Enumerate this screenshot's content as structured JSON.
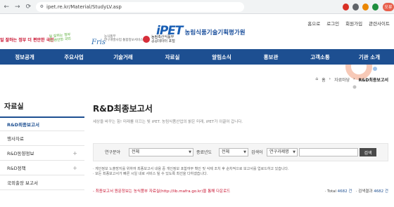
{
  "browser": {
    "url": "ipet.re.kr/Material/StudyLV.asp",
    "profile_label": "오류"
  },
  "header": {
    "util_links": [
      "홈으로",
      "로그인",
      "회원가입",
      "관련사이트"
    ],
    "banner_red": "일 잘하는 정부 더 편안한 국민",
    "banner_slogan_line1": "일 잘하는 정부",
    "banner_slogan_line2": "더 편안한 국민",
    "fris_logo": "Fris",
    "fris_sub_line1": "농식품부",
    "fris_sub_line2": "연구개발사업 통합정보서비스",
    "odp_line1": "농림축산식품부",
    "odp_line2": "공공데이터 포털",
    "ipet_logo": "iPET",
    "org_name": "농림식품기술기획평가원"
  },
  "gnb": [
    "정보공개",
    "주요사업",
    "기술거래",
    "자료실",
    "알림소식",
    "홍보관",
    "고객소통",
    "기관 소개"
  ],
  "breadcrumb": {
    "home": "홈",
    "parent": "자료마당",
    "current": "R&D최종보고서"
  },
  "lnb": {
    "title": "자료실",
    "items": [
      {
        "label": "R&D최종보고서",
        "active": true,
        "expandable": false
      },
      {
        "label": "행사자료",
        "active": false,
        "expandable": false
      },
      {
        "label": "R&D동향정보",
        "active": false,
        "expandable": true
      },
      {
        "label": "R&D정책",
        "active": false,
        "expandable": true
      },
      {
        "label": "국외출장 보고서",
        "active": false,
        "expandable": false
      }
    ]
  },
  "main": {
    "title": "R&D최종보고서",
    "description": "세상을 바꾸는 힘! 미래를 이끄는 빛 iPET. 농림식품산업의 밝은 미래, iPET가 이끌어 갑니다.",
    "search": {
      "field_label": "연구분야",
      "field_value": "전체",
      "year_label": "종료년도",
      "year_value": "전체",
      "target_label": "검색어",
      "target_value": "연구과제명",
      "button": "검색"
    },
    "notice_line1": "· 게인정보 노출방지를 위하여 최종보고서 내용 중 개인정보 포함여부 확인 및 삭제 조치 후 순차적으로 보고서를 업로드하고 있습니다.",
    "notice_line2": "· 모든 최종보고서가 빠른 시일 내로 서비스 될 수 있도록 최선을 다하겠습니다.",
    "notice_red": "- 최종보고서 원문정보는 농식품부 자료실(http://lib.mafra.go.kr)을 통해 다운로드",
    "total_label": "· Total",
    "total_value": "4682 건",
    "result_label": "· 검색결과",
    "result_value": "4682 건"
  },
  "colors": {
    "brand_blue": "#1d4f91",
    "accent_red": "#c8102e"
  }
}
